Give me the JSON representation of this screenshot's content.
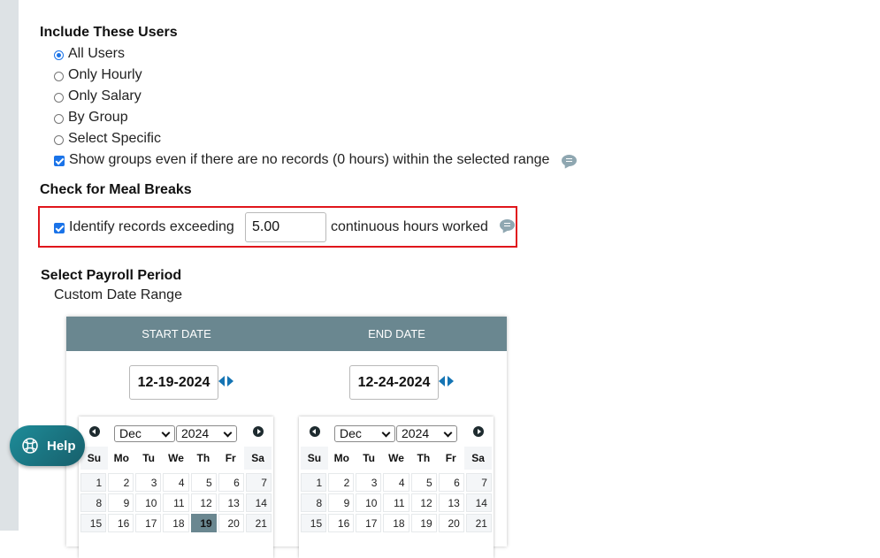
{
  "users_section": {
    "title": "Include These Users",
    "options": [
      {
        "label": "All Users",
        "checked": true
      },
      {
        "label": "Only Hourly",
        "checked": false
      },
      {
        "label": "Only Salary",
        "checked": false
      },
      {
        "label": "By Group",
        "checked": false
      },
      {
        "label": "Select Specific",
        "checked": false
      }
    ],
    "show_groups_label": "Show groups even if there are no records (0 hours) within the selected range",
    "show_groups_checked": true
  },
  "meal_breaks": {
    "title": "Check for Meal Breaks",
    "identify_label": "Identify records exceeding",
    "identify_checked": true,
    "hours_value": "5.00",
    "suffix_label": "continuous hours worked"
  },
  "payroll_period": {
    "title": "Select Payroll Period",
    "subtitle": "Custom Date Range",
    "start_header": "START DATE",
    "end_header": "END DATE",
    "start_date": "12-19-2024",
    "end_date": "12-24-2024",
    "weekdays": [
      "Su",
      "Mo",
      "Tu",
      "We",
      "Th",
      "Fr",
      "Sa"
    ],
    "start_calendar": {
      "month": "Dec",
      "year": "2024",
      "selected_day": 19
    },
    "end_calendar": {
      "month": "Dec",
      "year": "2024",
      "selected_day": null
    },
    "visible_days": [
      1,
      2,
      3,
      4,
      5,
      6,
      7,
      8,
      9,
      10,
      11,
      12,
      13,
      14,
      15,
      16,
      17,
      18,
      19,
      20,
      21
    ]
  },
  "help": {
    "label": "Help"
  },
  "colors": {
    "accent_blue": "#1a73e8",
    "highlight_red": "#e0161c",
    "header_slate": "#6a8790",
    "help_teal": "#1e8c99"
  }
}
